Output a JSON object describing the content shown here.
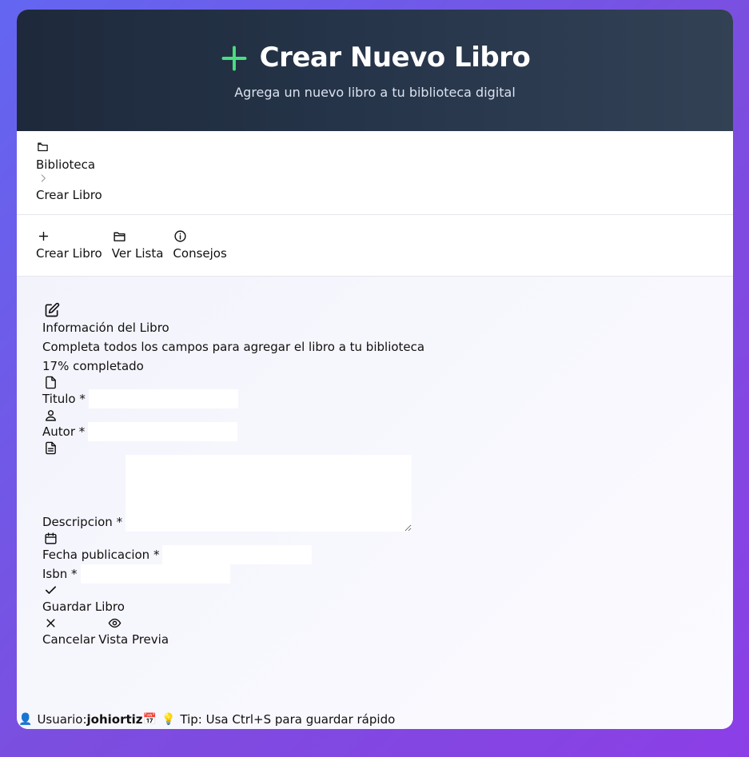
{
  "header": {
    "title": "Crear Nuevo Libro",
    "subtitle": "Agrega un nuevo libro a tu biblioteca digital",
    "icon": "plus-icon",
    "accent": "#4ade80"
  },
  "breadcrumb": {
    "items": [
      "Biblioteca",
      "Crear Libro"
    ]
  },
  "tabs": [
    {
      "label": "Crear Libro",
      "icon": "plus-icon"
    },
    {
      "label": "Ver Lista",
      "icon": "folder-icon"
    },
    {
      "label": "Consejos",
      "icon": "info-icon"
    }
  ],
  "form": {
    "section_title": "Información del Libro",
    "section_subtitle": "Completa todos los campos para agregar el libro a tu biblioteca",
    "progress_text": "17% completado",
    "progress_value": 0.17,
    "fields": {
      "titulo": {
        "label": "Titulo *",
        "value": ""
      },
      "autor": {
        "label": "Autor *",
        "value": ""
      },
      "descripcion": {
        "label": "Descripcion *",
        "value": ""
      },
      "fecha": {
        "label": "Fecha publicacion *",
        "value": ""
      },
      "isbn": {
        "label": "Isbn *",
        "value": ""
      }
    },
    "save_label": "Guardar Libro",
    "cancel_label": "Cancelar",
    "preview_label": "Vista Previa"
  },
  "footer": {
    "user_label": "Usuario:",
    "username": "johiortiz",
    "tip": "Tip: Usa Ctrl+S para guardar rápido"
  }
}
